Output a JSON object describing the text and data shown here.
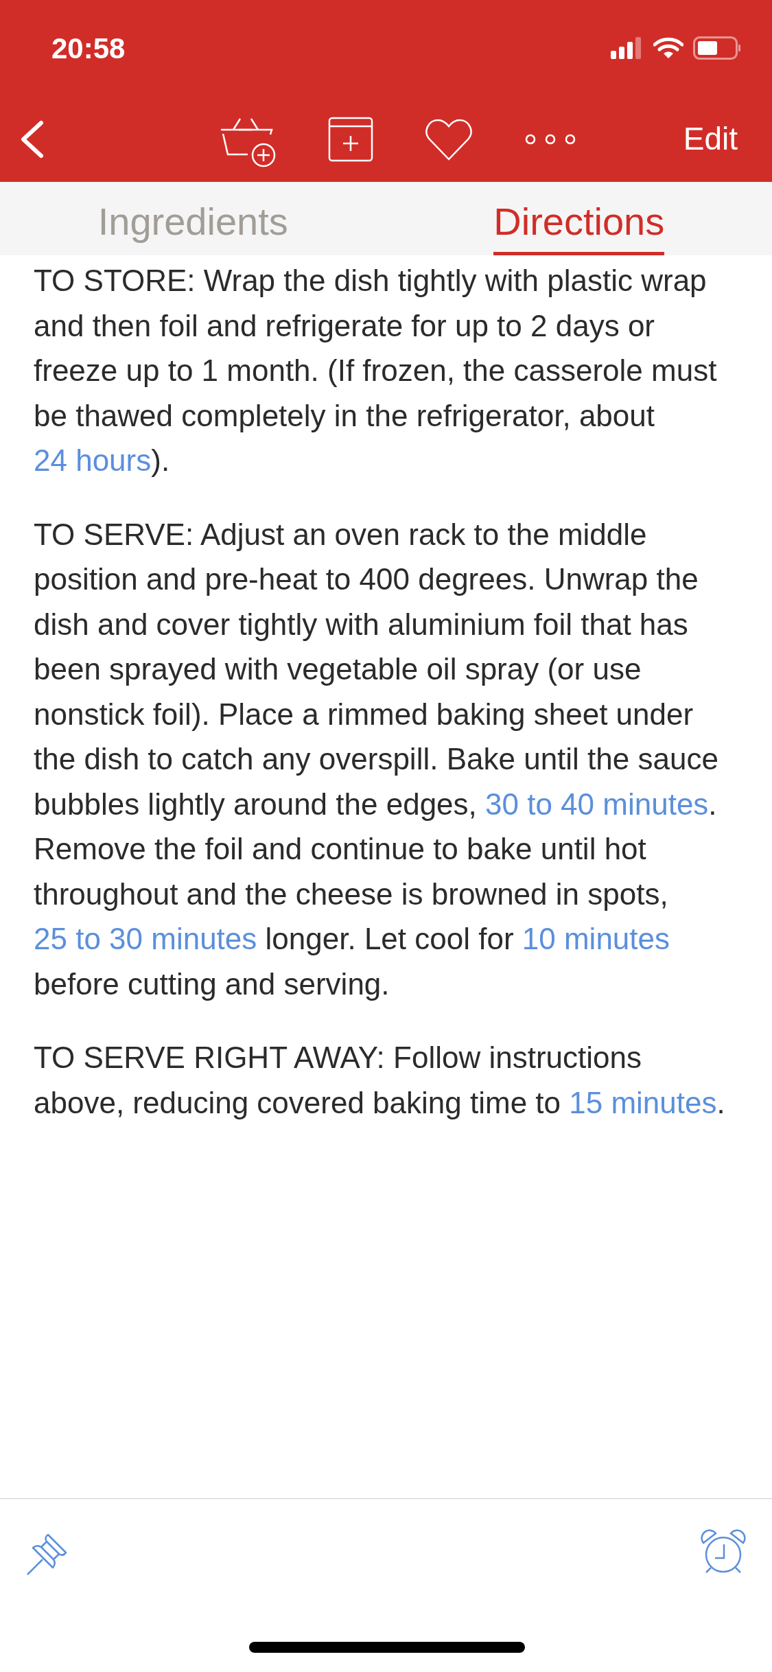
{
  "status_bar": {
    "time": "20:58"
  },
  "nav_bar": {
    "edit": "Edit"
  },
  "tabs": [
    {
      "label": "Ingredients",
      "selected": false
    },
    {
      "label": "Directions",
      "selected": true
    }
  ],
  "paragraphs": [
    [
      {
        "kind": "plain",
        "text": "TO STORE: Wrap the dish tightly with plastic wrap and then foil and refrigerate for up to 2 days or freeze up to 1 month. (If frozen, the casserole must be thawed completely in the refrigerator, about "
      },
      {
        "kind": "link",
        "text": "24 hours"
      },
      {
        "kind": "plain",
        "text": ")."
      }
    ],
    [
      {
        "kind": "plain",
        "text": "TO SERVE: Adjust an oven rack to the middle position and pre-heat to 400 degrees. Unwrap the dish and cover tightly with aluminium foil that has been sprayed with vegetable oil spray (or use nonstick foil). Place a rimmed baking sheet under the dish to catch any overspill. Bake until the sauce bubbles lightly around the edges, "
      },
      {
        "kind": "link",
        "text": "30 to 40 minutes"
      },
      {
        "kind": "plain",
        "text": ". Remove the foil and continue to bake until hot throughout and the cheese is browned in spots, "
      },
      {
        "kind": "link",
        "text": "25 to 30 minutes"
      },
      {
        "kind": "plain",
        "text": " longer. Let cool for "
      },
      {
        "kind": "link",
        "text": "10 minutes"
      },
      {
        "kind": "plain",
        "text": " before cutting and serving."
      }
    ],
    [
      {
        "kind": "plain",
        "text": "TO SERVE RIGHT AWAY: Follow instructions above, reducing covered baking time to "
      },
      {
        "kind": "link",
        "text": "15 minutes"
      },
      {
        "kind": "plain",
        "text": "."
      }
    ]
  ]
}
